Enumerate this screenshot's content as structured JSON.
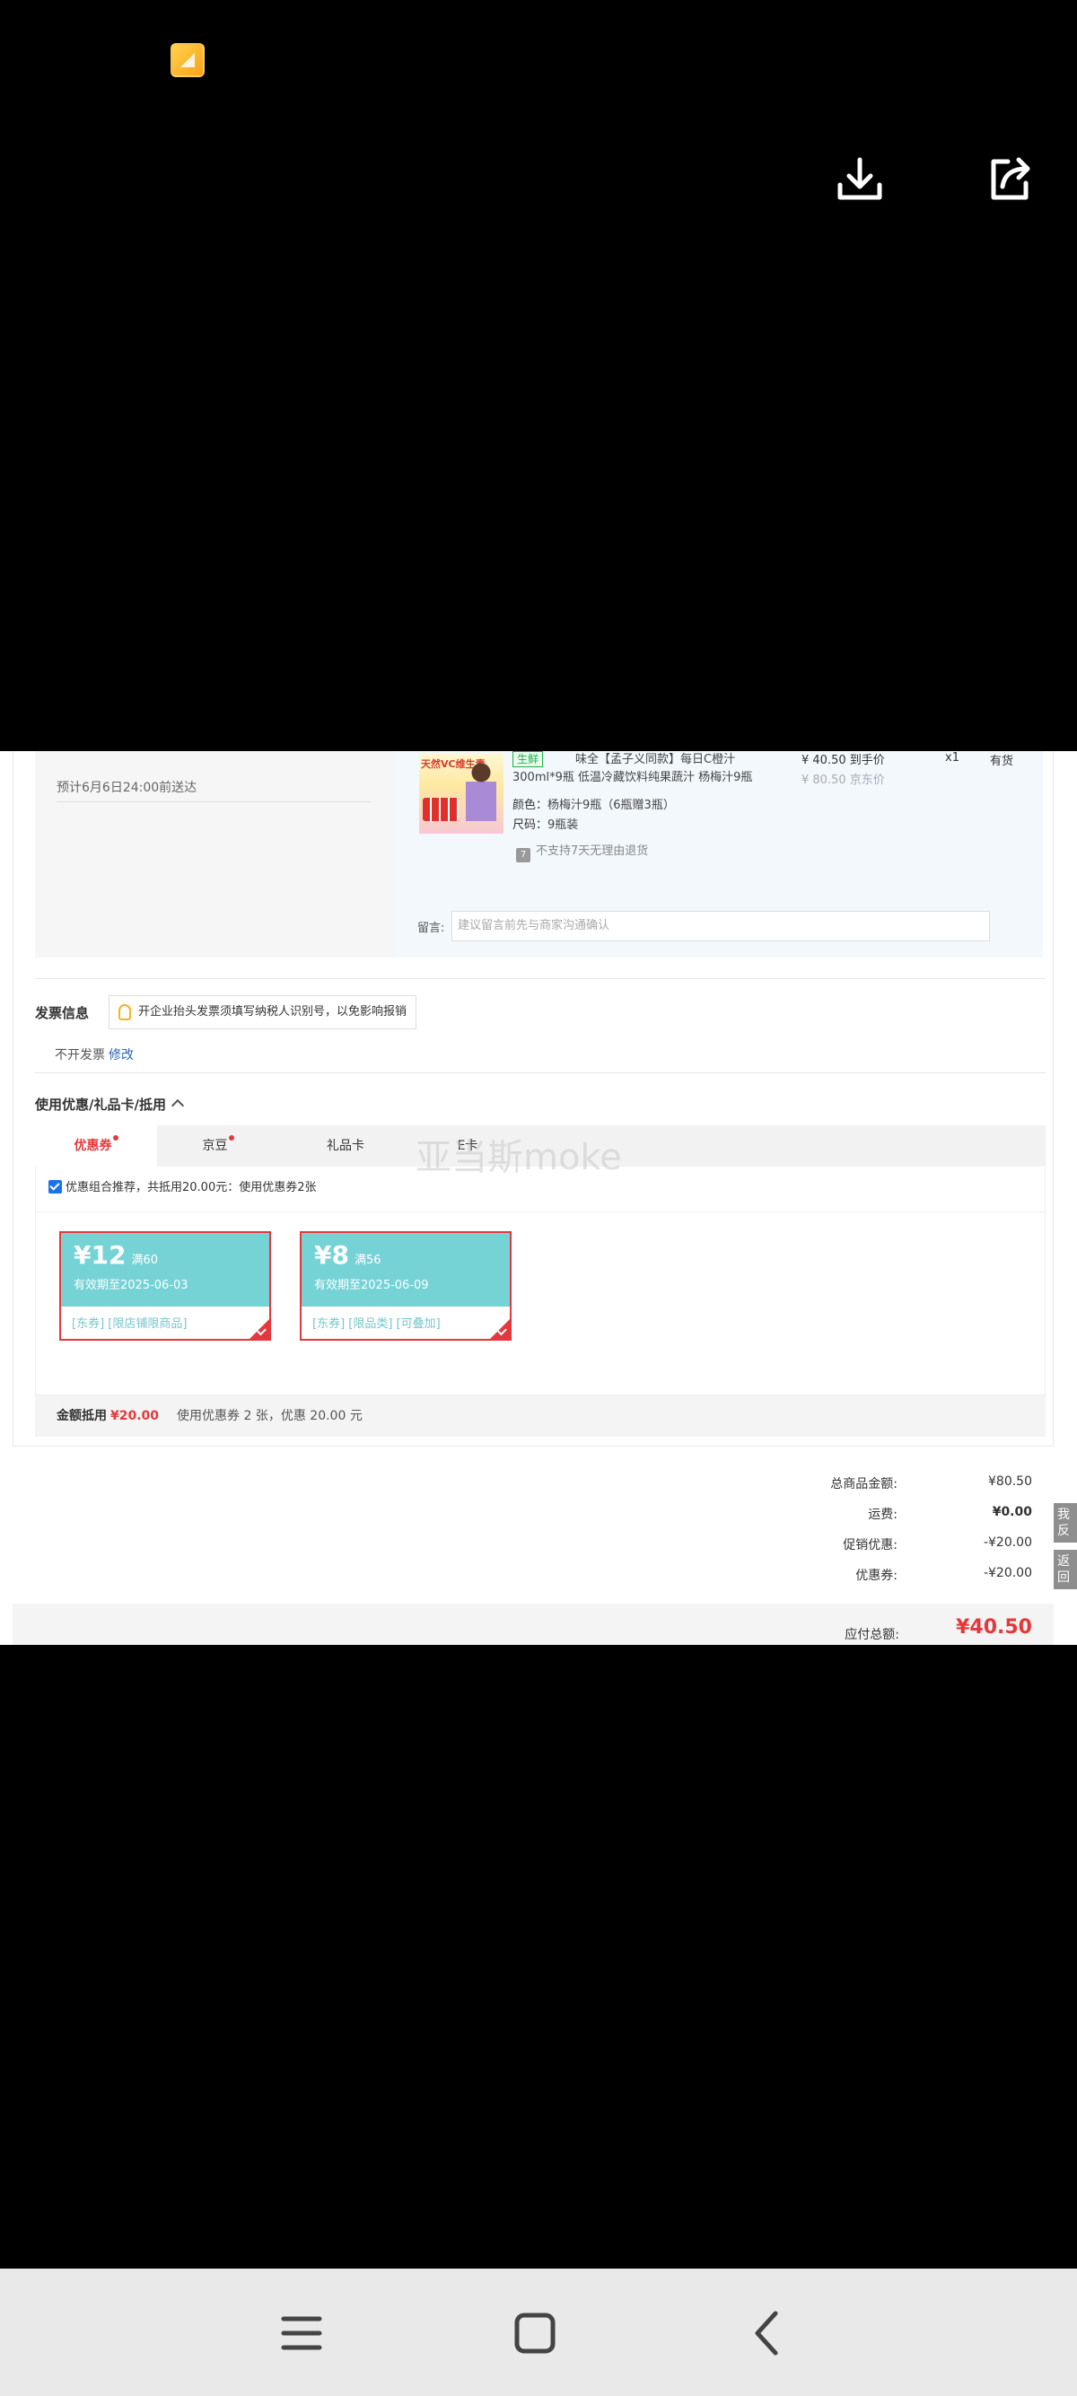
{
  "viewer": {
    "thumbnail_icon": "image-thumbnail-icon",
    "download_icon": "download-icon",
    "share_icon": "share-icon"
  },
  "shipping": {
    "eta": "预计6月6日24:00前送达"
  },
  "product": {
    "tag": "生鲜",
    "title_line1": "味全【孟子义同款】每日C橙汁",
    "title_line2": "300ml*9瓶 低温冷藏饮料纯果蔬汁 杨梅汁9瓶",
    "image_text": "天然VC维生素",
    "color_label": "颜色：",
    "color_value": "杨梅汁9瓶（6瓶赠3瓶）",
    "size_label": "尺码：",
    "size_value": "9瓶装",
    "no_return_badge": "7",
    "no_return": "不支持7天无理由退货",
    "price": "¥ 40.50 到手价",
    "orig_price": "¥ 80.50 京东价",
    "qty": "x1",
    "stock": "有货",
    "remark_label": "留言:",
    "remark_placeholder": "建议留言前先与商家沟通确认"
  },
  "invoice": {
    "title": "发票信息",
    "tip": "开企业抬头发票须填写纳税人识别号，以免影响报销",
    "status": "不开发票",
    "edit": "修改"
  },
  "discount": {
    "title": "使用优惠/礼品卡/抵用",
    "tabs": [
      {
        "label": "优惠券",
        "dot": true
      },
      {
        "label": "京豆",
        "dot": true
      },
      {
        "label": "礼品卡",
        "dot": false
      },
      {
        "label": "E卡",
        "dot": false
      }
    ],
    "recommend": "优惠组合推荐，共抵用20.00元：使用优惠券2张",
    "coupons": [
      {
        "amount": "¥12",
        "cond": "满60",
        "expire": "有效期至2025-06-03",
        "tags": "[东券]  [限店铺限商品]"
      },
      {
        "amount": "¥8",
        "cond": "满56",
        "expire": "有效期至2025-06-09",
        "tags": "[东券]  [限品类]  [可叠加]"
      }
    ],
    "deduct_label": "金额抵用",
    "deduct_amount": "¥20.00",
    "deduct_desc": "使用优惠券 2 张，优惠 20.00 元"
  },
  "watermark": "亚当斯moke",
  "summary": {
    "rows": [
      {
        "label": "总商品金额:",
        "value": "¥80.50"
      },
      {
        "label": "运费:",
        "value": "¥0.00"
      },
      {
        "label": "促销优惠:",
        "value": "-¥20.00"
      },
      {
        "label": "优惠券:",
        "value": "-¥20.00"
      }
    ],
    "total_label": "应付总额:",
    "total_value": "¥40.50",
    "side_tabs": [
      "我反",
      "返回"
    ]
  },
  "navbar": {
    "menu_icon": "menu-icon",
    "home_icon": "home-icon",
    "back_icon": "back-icon"
  }
}
